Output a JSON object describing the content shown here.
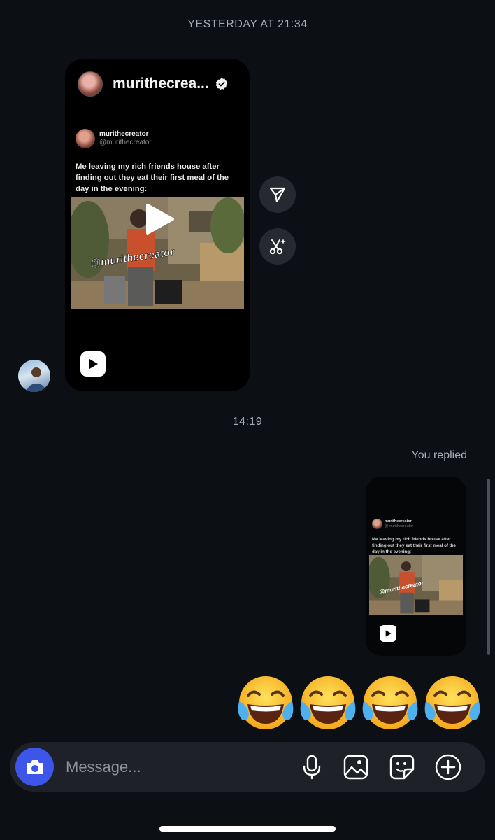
{
  "timestamps": {
    "first": "YESTERDAY AT 21:34",
    "second": "14:19"
  },
  "shared_post": {
    "account": "murithecrea...",
    "verified_icon": "verified-badge-icon",
    "tweet": {
      "name": "murithecreator",
      "handle": "@murithecreator",
      "text": "Me leaving my rich friends house after finding out they eat their first meal of the day in the evening:",
      "watermark": "@murithecreator"
    },
    "reel_icon": "reel-play-icon"
  },
  "side_actions": [
    {
      "icon": "share-send-icon"
    },
    {
      "icon": "ai-edit-icon"
    }
  ],
  "reply": {
    "label": "You replied",
    "preview": {
      "name": "murithecreator",
      "handle": "@murithecreator",
      "text": "Me leaving my rich friends house after finding out they eat their first meal of the day in the evening:",
      "watermark": "@murithecreator"
    }
  },
  "reaction_message": {
    "emojis": [
      "😂",
      "😂",
      "😂",
      "😂"
    ]
  },
  "composer": {
    "placeholder": "Message...",
    "value": "",
    "icons": [
      "camera-icon",
      "microphone-icon",
      "gallery-icon",
      "sticker-icon",
      "plus-circle-icon"
    ]
  },
  "colors": {
    "background": "#0c1014",
    "camera_button": "#3d55e8",
    "composer_bg": "#1e2127",
    "muted_text": "#a8adb5"
  }
}
